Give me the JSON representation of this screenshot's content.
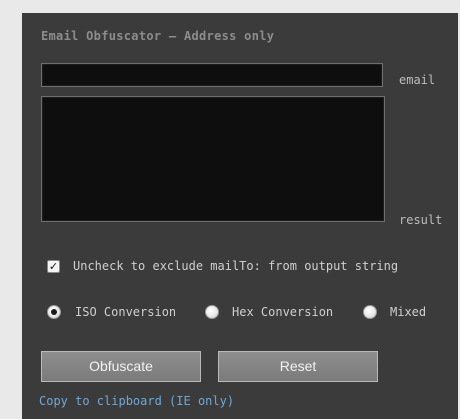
{
  "title": "Email Obfuscator — Address only",
  "fields": {
    "email_value": "",
    "email_label": "email",
    "result_value": "",
    "result_label": "result"
  },
  "options": {
    "mailto_checkbox_checked": true,
    "mailto_label": "Uncheck to exclude mailTo: from output string",
    "conversion": [
      {
        "label": "ISO Conversion",
        "selected": true
      },
      {
        "label": "Hex Conversion",
        "selected": false
      },
      {
        "label": "Mixed",
        "selected": false
      }
    ]
  },
  "buttons": {
    "obfuscate": "Obfuscate",
    "reset": "Reset"
  },
  "copy_link": "Copy to clipboard (IE only)",
  "colors": {
    "panel_bg": "#3b3b3b",
    "link": "#6fa7d8"
  }
}
